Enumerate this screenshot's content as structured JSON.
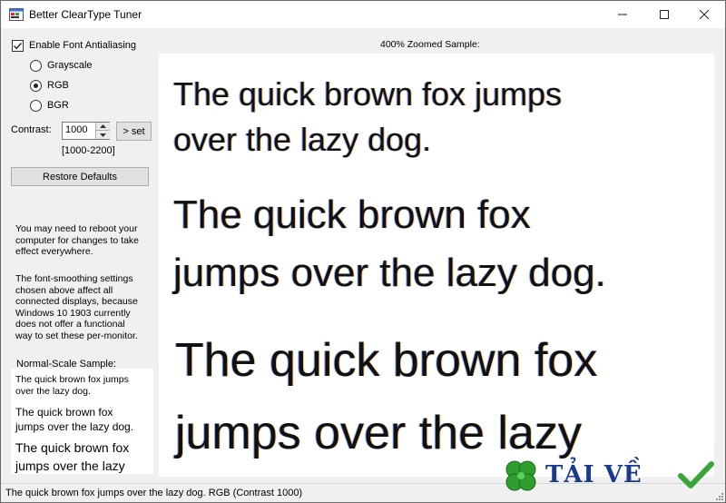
{
  "window": {
    "title": "Better ClearType Tuner"
  },
  "left_panel": {
    "antialias_label": "Enable Font Antialiasing",
    "antialias_checked": true,
    "modes": [
      {
        "label": "Grayscale",
        "selected": false
      },
      {
        "label": "RGB",
        "selected": true
      },
      {
        "label": "BGR",
        "selected": false
      }
    ],
    "contrast_label": "Contrast:",
    "contrast_value": "1000",
    "set_label": "> set",
    "range_label": "[1000-2200]",
    "restore_label": "Restore Defaults",
    "info1": "You may need to reboot your\ncomputer for changes to take\neffect everywhere.",
    "info2": "The font-smoothing settings\nchosen above affect all\nconnected displays, because\nWindows 10 1903 currently\ndoes not offer a functional\nway to set these per-monitor.",
    "normal_label": "Normal-Scale Sample:",
    "normal_samples": [
      "The quick brown fox jumps\nover the lazy dog.",
      "The quick brown fox\njumps over the lazy dog.",
      "The quick brown fox\njumps over the lazy"
    ]
  },
  "zoom": {
    "caption": "400% Zoomed Sample:",
    "samples": [
      "The quick brown fox jumps\nover the lazy dog.",
      "The quick brown fox\njumps over the lazy dog.",
      "The quick brown fox\njumps over the lazy"
    ]
  },
  "status": {
    "text": "The quick brown fox jumps over the lazy dog. RGB (Contrast 1000)"
  },
  "watermark": {
    "text": "TẢI VỀ"
  },
  "colors": {
    "window_bg": "#f0f0f0",
    "panel_bg": "#ffffff",
    "watermark_blue": "#1b3a8f",
    "clover_green": "#2e9e2e",
    "check_green": "#3aa63a"
  }
}
